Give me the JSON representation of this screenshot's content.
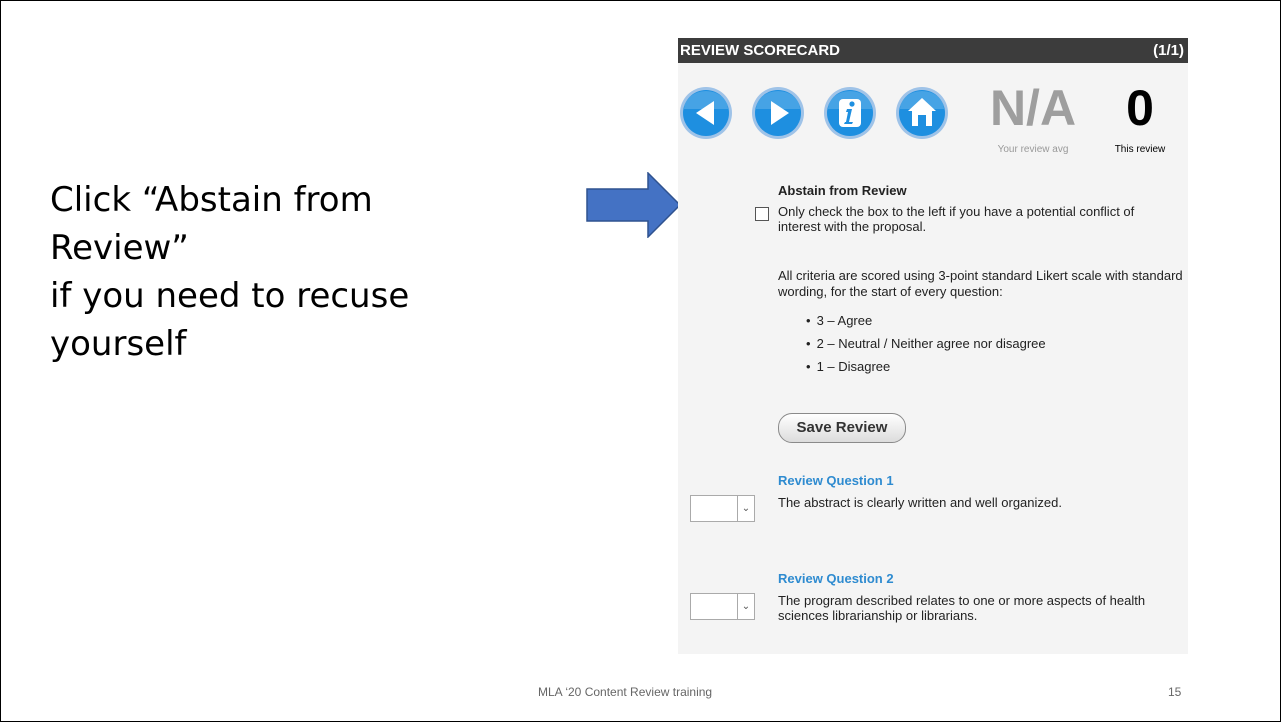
{
  "instruction": {
    "line1": "Click “Abstain from",
    "line2": "Review”",
    "line3": "if you need to recuse",
    "line4": "yourself"
  },
  "scorecard": {
    "title": "REVIEW SCORECARD",
    "page": "(1/1)",
    "nav_icons": [
      "back-arrow-icon",
      "forward-arrow-icon",
      "info-icon",
      "home-icon"
    ],
    "avg_value": "N/A",
    "avg_label": "Your review avg",
    "this_value": "0",
    "this_label": "This review",
    "abstain_title": "Abstain from Review",
    "abstain_text": "Only check the box to the left if you have a potential conflict of interest with the proposal.",
    "abstain_checked": false,
    "likert_intro": "All criteria are scored using 3-point standard Likert scale with standard wording, for the start of every question:",
    "likert_options": [
      "3 – Agree",
      "2 – Neutral / Neither agree nor disagree",
      "1 – Disagree"
    ],
    "save_label": "Save Review",
    "questions": [
      {
        "title": "Review Question 1",
        "text": "The abstract is clearly written and well organized."
      },
      {
        "title": "Review Question 2",
        "text": "The program described relates to one or more aspects of health sciences librarianship or librarians."
      }
    ]
  },
  "footer": {
    "text": "MLA ‘20 Content Review training",
    "page_number": "15"
  },
  "colors": {
    "arrow": "#4472c4",
    "header_bg": "#3c3c3c",
    "nav_button": "#1e8fe0",
    "question_title": "#2e8bd0",
    "avg_value": "#9e9e9e"
  }
}
